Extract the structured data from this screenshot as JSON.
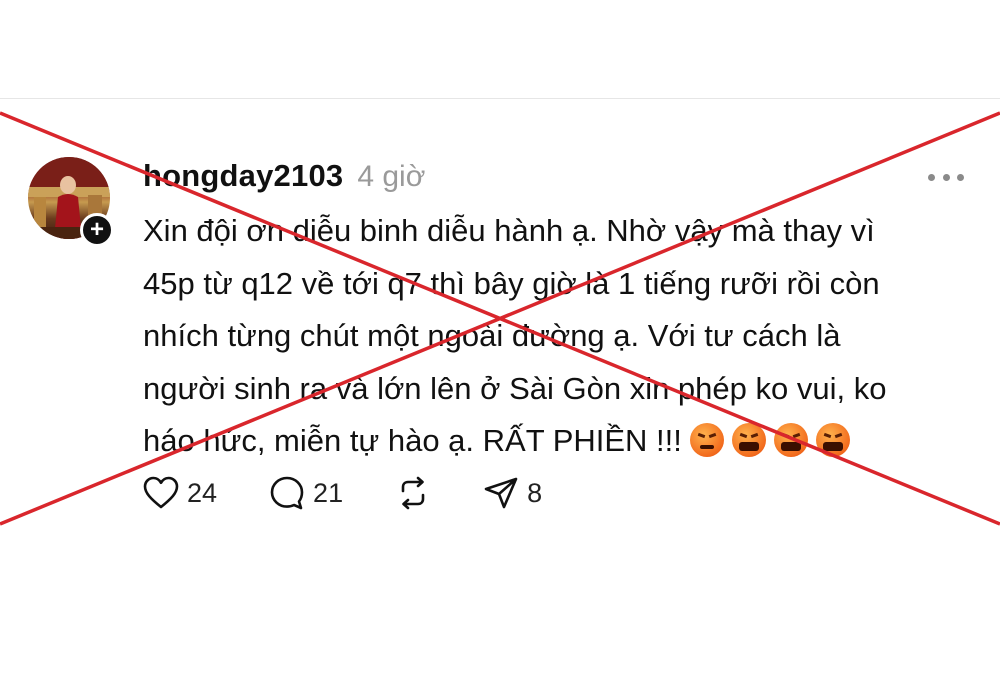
{
  "post": {
    "username": "hongday2103",
    "timestamp": "4 giờ",
    "avatar_badge": "+",
    "body_lines": [
      "Xin đội ơn diễu binh diễu hành ạ. Nhờ vậy mà thay vì",
      "45p từ q12 về tới q7 thì bây giờ là 1 tiếng rưỡi rồi còn",
      "nhích từng chút một ngoài đường ạ. Với tư cách là",
      "người sinh ra và lớn lên ở Sài Gòn xin phép ko vui, ko",
      "háo hức, miễn tự hào ạ. RẤT PHIỀN !!!"
    ],
    "emoji": [
      "pouting-face",
      "face-with-symbols-on-mouth",
      "face-with-symbols-on-mouth",
      "face-with-symbols-on-mouth"
    ],
    "actions": {
      "likes": "24",
      "comments": "21",
      "shares": "8"
    }
  },
  "icons": {
    "like": "heart-icon",
    "comment": "comment-icon",
    "repost": "repost-icon",
    "share": "send-icon",
    "more": "more-dots-icon"
  },
  "colors": {
    "cross_line": "#d9262c",
    "username": "#111111",
    "timestamp": "#9a9a9a"
  }
}
